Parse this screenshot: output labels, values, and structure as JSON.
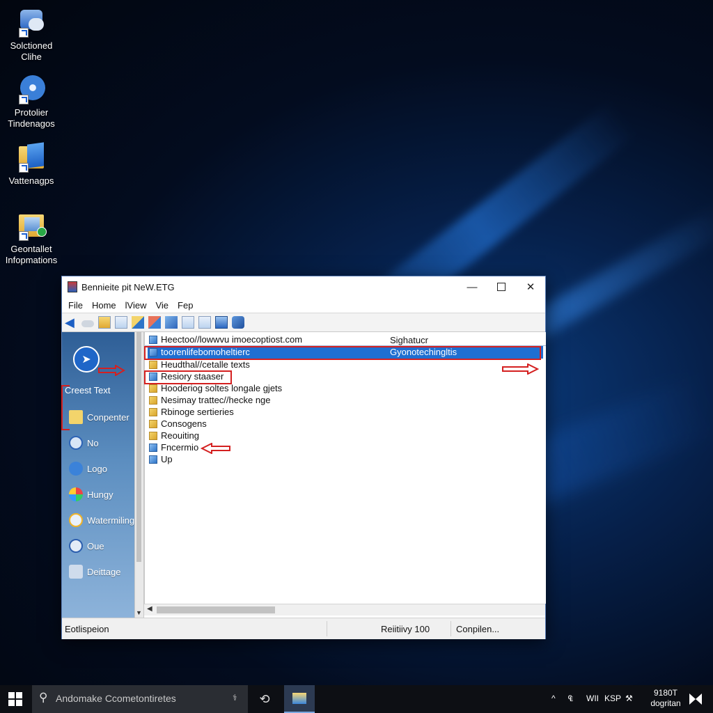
{
  "desktop": {
    "icons": [
      {
        "label_line1": "Solctioned",
        "label_line2": "Clihe"
      },
      {
        "label_line1": "Protolier",
        "label_line2": "Tindenagos"
      },
      {
        "label_line1": "Vattenagps",
        "label_line2": ""
      },
      {
        "label_line1": "Geontallet",
        "label_line2": "Infopmations"
      }
    ]
  },
  "window": {
    "title": "Bennieite pit NeW.ETG",
    "menu": [
      "File",
      "Home",
      "lView",
      "Vie",
      "Fep"
    ],
    "nav": {
      "top_label": "Creest Text",
      "items": [
        "Conpenter",
        "No",
        "Logo",
        "Hungy",
        "Watermiling",
        "Oue",
        "Deittage"
      ]
    },
    "list": {
      "rows": [
        {
          "name": "Heectoo//lowwvu imoecoptiost.com",
          "col2": "Sighatucr"
        },
        {
          "name": "toorenlifebomoheltierc",
          "col2": "Gyonotechingltis",
          "selected": true
        },
        {
          "name": "Heudthal//cetalle texts",
          "col2": ""
        },
        {
          "name": "Resiory staaser",
          "col2": ""
        },
        {
          "name": "Hooderiog soltes longale gjets",
          "col2": ""
        },
        {
          "name": "Nesimay trattec//hecke nge",
          "col2": ""
        },
        {
          "name": "Rbinoge sertieries",
          "col2": ""
        },
        {
          "name": "Consogens",
          "col2": ""
        },
        {
          "name": "Reouiting",
          "col2": ""
        },
        {
          "name": "Fncermio",
          "col2": ""
        },
        {
          "name": "Up",
          "col2": ""
        }
      ]
    },
    "status": {
      "left": "Eotlispeion",
      "mid": "Reiitiivy 100",
      "right": "Conpilen..."
    }
  },
  "taskbar": {
    "search_text": "Andomake Ccometontiretes",
    "tray": [
      "^",
      "₠",
      "WII",
      "KSP",
      "⚒"
    ],
    "clock_line1": "9180T",
    "clock_line2": "dogritan"
  },
  "colors": {
    "selection": "#1f6fd1",
    "annotation": "#d42020"
  }
}
